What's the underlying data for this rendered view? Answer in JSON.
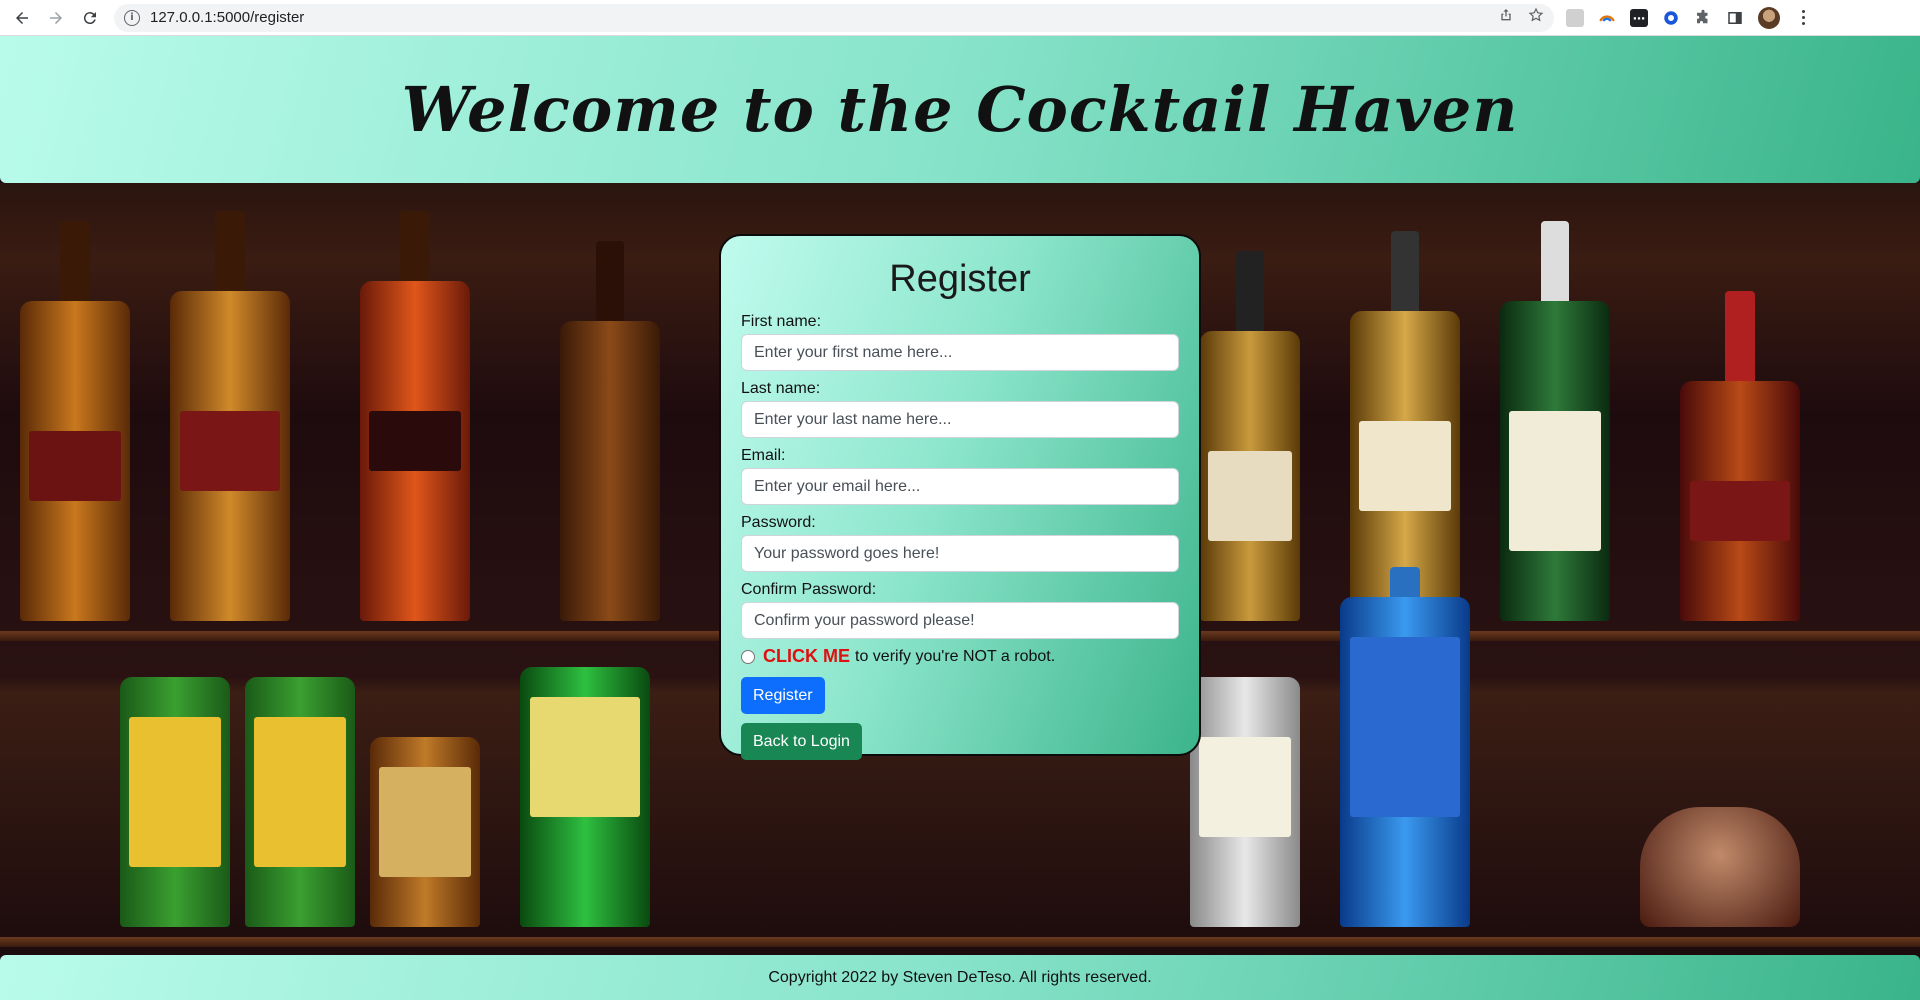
{
  "browser": {
    "url": "127.0.0.1:5000/register",
    "icons": [
      "back-icon",
      "forward-icon",
      "reload-icon",
      "info-icon",
      "share-icon",
      "star-icon",
      "extension-icon",
      "puzzle-icon",
      "side-panel-icon",
      "avatar",
      "menu-icon"
    ]
  },
  "header": {
    "title": "Welcome to the Cocktail Haven"
  },
  "register": {
    "heading": "Register",
    "first_name": {
      "label": "First name:",
      "placeholder": "Enter your first name here..."
    },
    "last_name": {
      "label": "Last name:",
      "placeholder": "Enter your last name here..."
    },
    "email": {
      "label": "Email:",
      "placeholder": "Enter your email here..."
    },
    "password": {
      "label": "Password:",
      "placeholder": "Your password goes here!"
    },
    "confirm_password": {
      "label": "Confirm Password:",
      "placeholder": "Confirm your password please!"
    },
    "robot_click": "CLICK ME",
    "robot_text": "to verify you're NOT a robot.",
    "register_button": "Register",
    "back_button": "Back to Login"
  },
  "footer": {
    "text": "Copyright 2022 by Steven DeTeso. All rights reserved."
  },
  "colors": {
    "accent_mint": "#86e3c9",
    "accent_green": "#3ab48a",
    "primary_button": "#0d6efd",
    "success_button": "#198754",
    "click_me": "#e01010"
  }
}
